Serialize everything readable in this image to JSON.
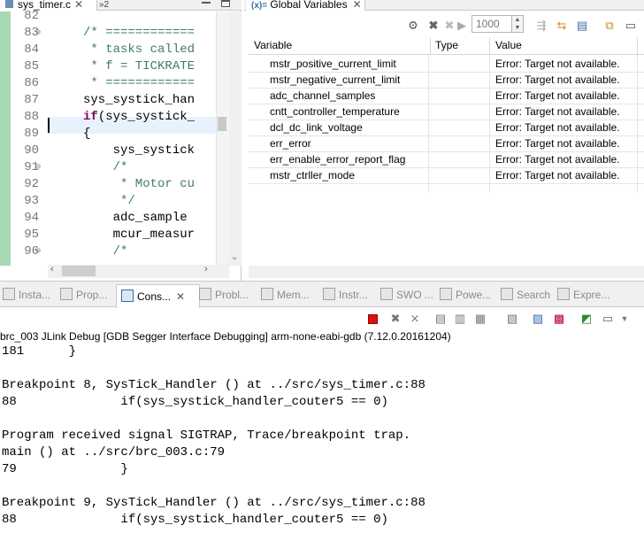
{
  "editor": {
    "tab_label": "sys_timer.c",
    "overflow_label": "»2",
    "lines": [
      {
        "num": "82",
        "text": "",
        "cls": "",
        "fold": ""
      },
      {
        "num": "83",
        "text": "/* ============",
        "cls": "cmt",
        "fold": "⊖"
      },
      {
        "num": "84",
        "text": " * tasks called",
        "cls": "cmt",
        "fold": ""
      },
      {
        "num": "85",
        "text": " * f = TICKRATE",
        "cls": "cmt",
        "fold": ""
      },
      {
        "num": "86",
        "text": " * ============",
        "cls": "cmt",
        "fold": ""
      },
      {
        "num": "87",
        "text": "sys_systick_han",
        "cls": "",
        "fold": ""
      },
      {
        "num": "88",
        "text": "if(sys_systick_",
        "cls": "if",
        "fold": ""
      },
      {
        "num": "89",
        "text": "{",
        "cls": "",
        "fold": ""
      },
      {
        "num": "90",
        "text": "    sys_systick",
        "cls": "",
        "fold": ""
      },
      {
        "num": "91",
        "text": "    /*",
        "cls": "cmt",
        "fold": "⊖"
      },
      {
        "num": "92",
        "text": "     * Motor cu",
        "cls": "cmt",
        "fold": ""
      },
      {
        "num": "93",
        "text": "     */",
        "cls": "cmt",
        "fold": ""
      },
      {
        "num": "94",
        "text": "    adc_sample",
        "cls": "",
        "fold": ""
      },
      {
        "num": "95",
        "text": "    mcur_measur",
        "cls": "",
        "fold": ""
      },
      {
        "num": "96",
        "text": "    /*",
        "cls": "cmt",
        "fold": "⊖"
      }
    ]
  },
  "variables": {
    "tab_label": "Global Variables",
    "tab_icon": "(x)=",
    "generation_count": "1000",
    "columns": [
      "Variable",
      "Type",
      "Value"
    ],
    "rows": [
      {
        "name": "mstr_positive_current_limit",
        "type": "",
        "value": "Error: Target not available."
      },
      {
        "name": "mstr_negative_current_limit",
        "type": "",
        "value": "Error: Target not available."
      },
      {
        "name": "adc_channel_samples",
        "type": "",
        "value": "Error: Target not available."
      },
      {
        "name": "cntt_controller_temperature",
        "type": "",
        "value": "Error: Target not available."
      },
      {
        "name": "dcl_dc_link_voltage",
        "type": "",
        "value": "Error: Target not available."
      },
      {
        "name": "err_error",
        "type": "",
        "value": "Error: Target not available."
      },
      {
        "name": "err_enable_error_report_flag",
        "type": "",
        "value": "Error: Target not available."
      },
      {
        "name": "mstr_ctrller_mode",
        "type": "",
        "value": "Error: Target not available."
      }
    ]
  },
  "bottom_tabs": {
    "installations": "Insta...",
    "properties": "Prop...",
    "console": "Cons...",
    "problems": "Probl...",
    "memory": "Mem...",
    "instructions": "Instr...",
    "swo": "SWO ...",
    "power": "Powe...",
    "search": "Search",
    "expressions": "Expre..."
  },
  "console": {
    "title": "brc_003 JLink Debug [GDB Segger Interface Debugging] arm-none-eabi-gdb (7.12.0.20161204)",
    "lines": [
      "181      }",
      "",
      "Breakpoint 8, SysTick_Handler () at ../src/sys_timer.c:88",
      "88              if(sys_systick_handler_couter5 == 0)",
      "",
      "Program received signal SIGTRAP, Trace/breakpoint trap.",
      "main () at ../src/brc_003.c:79",
      "79              }",
      "",
      "Breakpoint 9, SysTick_Handler () at ../src/sys_timer.c:88",
      "88              if(sys_systick_handler_couter5 == 0)"
    ]
  }
}
